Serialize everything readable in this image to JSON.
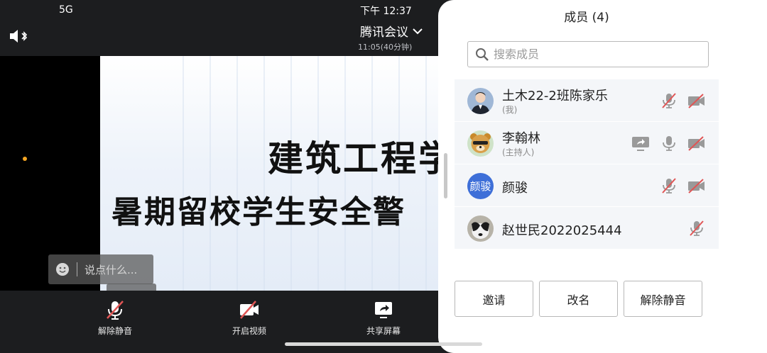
{
  "status_bar": {
    "signal": "5G",
    "time": "下午 12:37"
  },
  "meeting": {
    "title": "腾讯会议",
    "elapsed": "11:05(40分钟)",
    "slide_line1": "建筑工程学",
    "slide_line2": "暑期留校学生安全警",
    "chat_placeholder": "说点什么..."
  },
  "toolbar": {
    "unmute_label": "解除静音",
    "start_video_label": "开启视频",
    "share_screen_label": "共享屏幕"
  },
  "panel": {
    "title": "成员 (4)",
    "search_placeholder": "搜索成员",
    "members": [
      {
        "name": "土木22-2班陈家乐",
        "role": "(我)",
        "avatar": "photo-young-man",
        "mic": "muted",
        "camera": "off"
      },
      {
        "name": "李翰林",
        "role": "(主持人)",
        "avatar": "photo-bear-character",
        "screen_share": true,
        "mic": "on",
        "camera": "off"
      },
      {
        "name": "颜骏",
        "role": "",
        "avatar_text": "颜骏",
        "mic": "muted",
        "camera": "off"
      },
      {
        "name": "赵世民2022025444",
        "role": "",
        "avatar": "photo-dog",
        "mic": "muted"
      }
    ],
    "buttons": {
      "invite": "邀请",
      "rename": "改名",
      "unmute": "解除静音"
    }
  },
  "colors": {
    "accent": "#3e6fd8",
    "muted_red": "#e05555",
    "panel_bg": "#ffffff",
    "dark_bg": "#1c1d1f"
  }
}
